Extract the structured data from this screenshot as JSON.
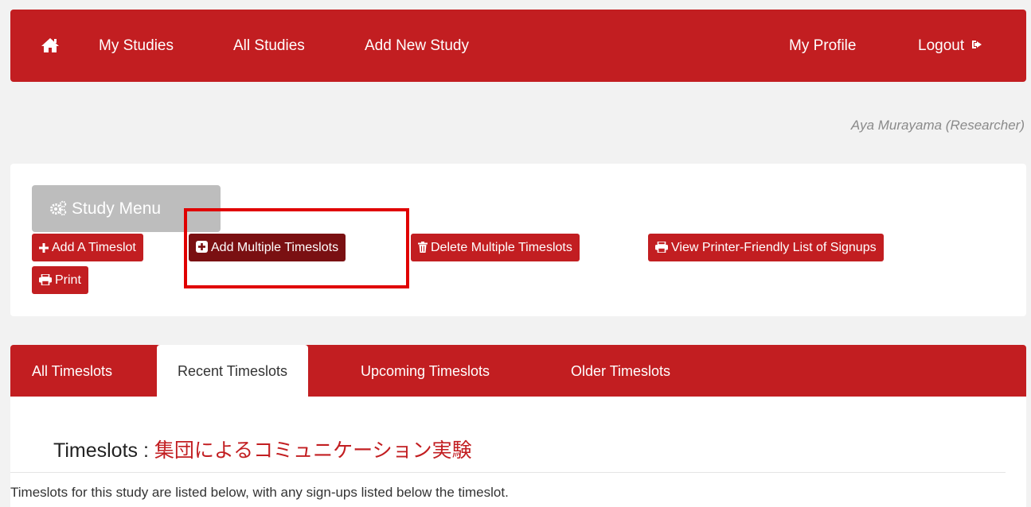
{
  "navbar": {
    "home_icon": "home-icon",
    "links": {
      "my_studies": "My Studies",
      "all_studies": "All Studies",
      "add_new_study": "Add New Study",
      "my_profile": "My Profile",
      "logout": "Logout"
    },
    "logout_icon": "logout-icon",
    "color": "#c21e21"
  },
  "user_line": "Aya Murayama (Researcher)",
  "study_menu": {
    "label": "Study Menu",
    "icon": "cogs-icon"
  },
  "actions": {
    "add_timeslot": "Add A Timeslot",
    "add_multiple_timeslots": "Add Multiple Timeslots",
    "delete_multiple_timeslots": "Delete Multiple Timeslots",
    "view_printer_friendly": "View Printer-Friendly List of Signups",
    "print": "Print"
  },
  "tabs": {
    "all": "All Timeslots",
    "recent": "Recent Timeslots",
    "upcoming": "Upcoming Timeslots",
    "older": "Older Timeslots",
    "active": "recent"
  },
  "content": {
    "title_prefix": "Timeslots : ",
    "study_name": "集団によるコミュニケーション実験",
    "description": "Timeslots for this study are listed below, with any sign-ups listed below the timeslot."
  },
  "colors": {
    "brand_red": "#c21e21",
    "active_button": "#7a1012",
    "highlight": "#e00000",
    "disabled_gray": "#bdbdbd"
  }
}
